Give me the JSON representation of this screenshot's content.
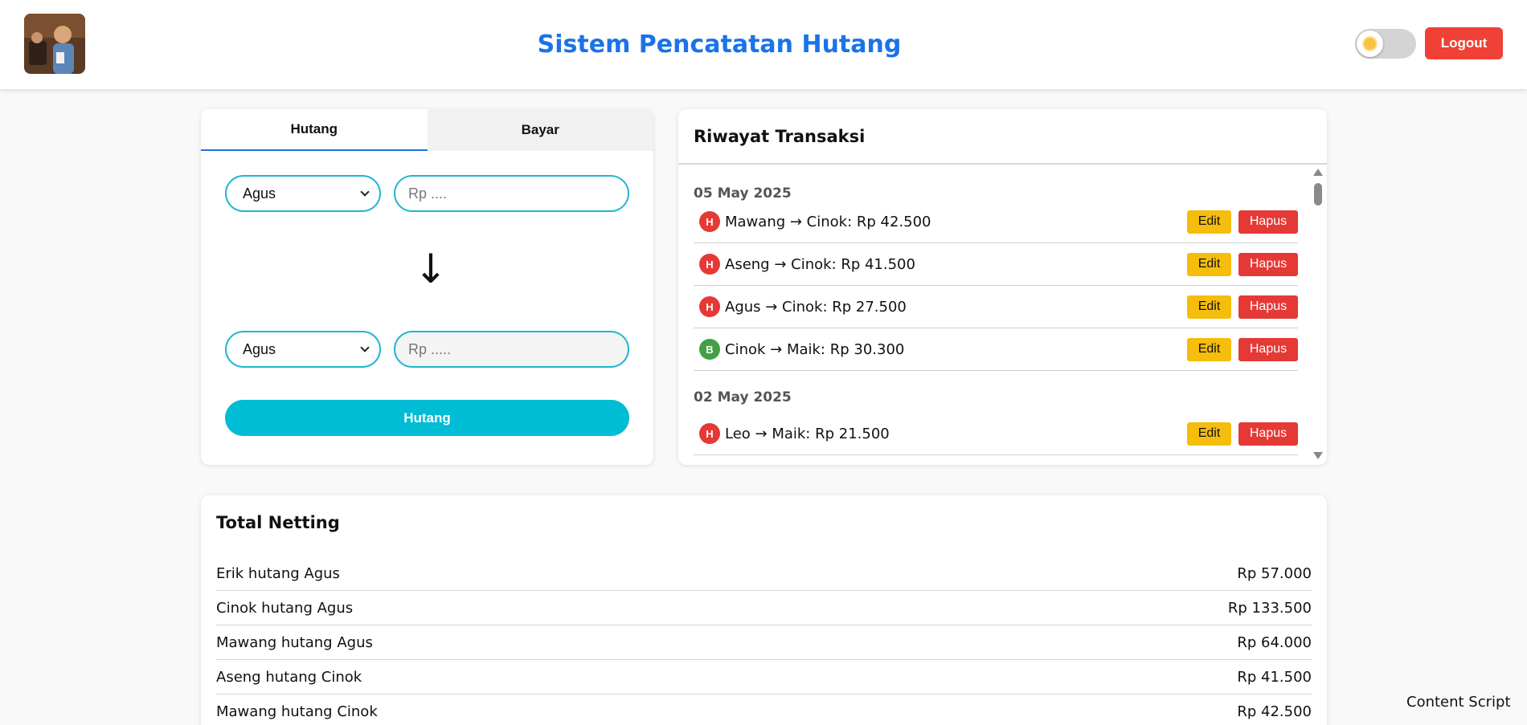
{
  "header": {
    "title": "Sistem Pencatatan Hutang",
    "logout_label": "Logout"
  },
  "form": {
    "tabs": [
      {
        "label": "Hutang",
        "active": true
      },
      {
        "label": "Bayar",
        "active": false
      }
    ],
    "from_person": "Agus",
    "from_amount_placeholder": "Rp ....",
    "to_person": "Agus",
    "to_amount_placeholder": "Rp .....",
    "submit_label": "Hutang"
  },
  "history": {
    "title": "Riwayat Transaksi",
    "groups": [
      {
        "date": "05 May 2025",
        "items": [
          {
            "type": "H",
            "text": "Mawang → Cinok: Rp 42.500"
          },
          {
            "type": "H",
            "text": "Aseng → Cinok: Rp 41.500"
          },
          {
            "type": "H",
            "text": "Agus → Cinok: Rp 27.500"
          },
          {
            "type": "B",
            "text": "Cinok → Maik: Rp 30.300"
          }
        ]
      },
      {
        "date": "02 May 2025",
        "items": [
          {
            "type": "H",
            "text": "Leo → Maik: Rp 21.500"
          }
        ]
      }
    ],
    "edit_label": "Edit",
    "delete_label": "Hapus"
  },
  "netting": {
    "title": "Total Netting",
    "rows": [
      {
        "label": "Erik hutang Agus",
        "amount": "Rp 57.000"
      },
      {
        "label": "Cinok hutang Agus",
        "amount": "Rp 133.500"
      },
      {
        "label": "Mawang hutang Agus",
        "amount": "Rp 64.000"
      },
      {
        "label": "Aseng hutang Cinok",
        "amount": "Rp 41.500"
      },
      {
        "label": "Mawang hutang Cinok",
        "amount": "Rp 42.500"
      }
    ]
  },
  "footer": {
    "content_script": "Content Script"
  },
  "colors": {
    "accent": "#1a73e8",
    "button_cyan": "#00bcd4",
    "logout_red": "#ef4136",
    "edit_yellow": "#f5bd0c",
    "delete_red": "#e53935",
    "badge_hutang": "#e53935",
    "badge_bayar": "#43a047"
  }
}
